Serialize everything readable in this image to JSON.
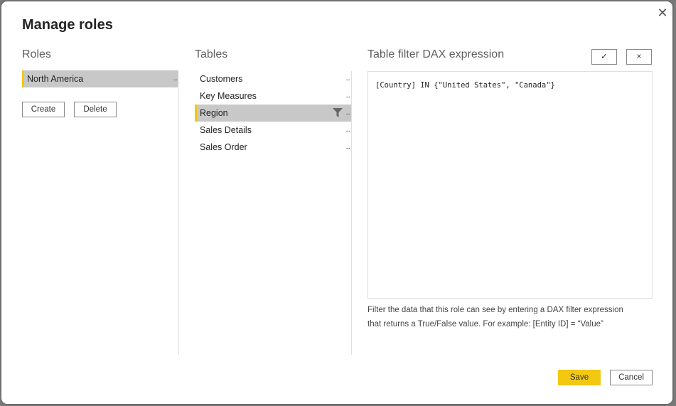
{
  "dialog": {
    "title": "Manage roles",
    "close_glyph": "✕"
  },
  "roles": {
    "heading": "Roles",
    "items": [
      {
        "label": "North America",
        "selected": true,
        "menu": "..."
      }
    ],
    "create_label": "Create",
    "delete_label": "Delete"
  },
  "tables": {
    "heading": "Tables",
    "items": [
      {
        "label": "Customers",
        "menu": "...",
        "filtered": false,
        "selected": false
      },
      {
        "label": "Key Measures",
        "menu": "...",
        "filtered": false,
        "selected": false
      },
      {
        "label": "Region",
        "menu": "...",
        "filtered": true,
        "selected": true
      },
      {
        "label": "Sales Details",
        "menu": "...",
        "filtered": false,
        "selected": false
      },
      {
        "label": "Sales Order",
        "menu": "...",
        "filtered": false,
        "selected": false
      }
    ]
  },
  "filter": {
    "heading": "Table filter DAX expression",
    "accept_glyph": "✓",
    "discard_glyph": "×",
    "expression": "[Country] IN {\"United States\", \"Canada\"}",
    "help_line1": "Filter the data that this role can see by entering a DAX filter expression",
    "help_line2": "that returns a True/False value. For example: [Entity ID] = “Value”"
  },
  "footer": {
    "save_label": "Save",
    "cancel_label": "Cancel"
  },
  "colors": {
    "accent": "#f2c811",
    "selected_bg": "#c8c8c8"
  }
}
